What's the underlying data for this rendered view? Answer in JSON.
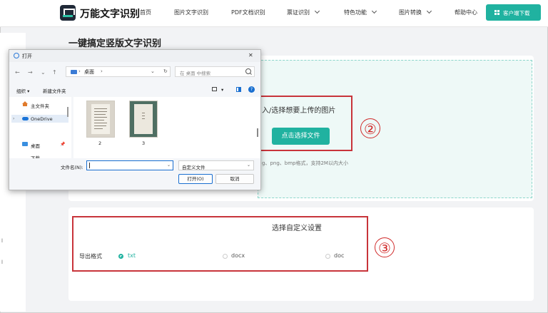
{
  "header": {
    "brand": "万能文字识别",
    "nav": [
      {
        "label": "首页",
        "dropdown": false
      },
      {
        "label": "图片文字识别",
        "dropdown": false
      },
      {
        "label": "PDF文档识别",
        "dropdown": false
      },
      {
        "label": "票证识别",
        "dropdown": true
      },
      {
        "label": "特色功能",
        "dropdown": true
      },
      {
        "label": "图片转换",
        "dropdown": true
      },
      {
        "label": "帮助中心",
        "dropdown": false
      }
    ],
    "download_button": "客户端下载"
  },
  "sidebar": {
    "marks": [
      "l",
      "l"
    ]
  },
  "main": {
    "title": "一键搞定竖版文字识别",
    "upload": {
      "prompt": "入/选择想要上传的图片",
      "choose_button": "点击选择文件",
      "hint": "g、png、bmp格式，支持2M以内大小"
    },
    "settings": {
      "title": "选择自定义设置",
      "export_label": "导出格式",
      "formats": [
        {
          "label": "txt",
          "selected": true
        },
        {
          "label": "docx",
          "selected": false
        },
        {
          "label": "doc",
          "selected": false
        }
      ]
    },
    "annotations": [
      "②",
      "③"
    ]
  },
  "dialog": {
    "title": "打开",
    "close": "✕",
    "nav_buttons": [
      "←",
      "→",
      "⌄",
      "↑"
    ],
    "address": {
      "location": "桌面",
      "sep": "›",
      "chevron": "⌄",
      "refresh": "↻"
    },
    "search_placeholder": "在 桌面 中搜索",
    "toolbar": {
      "organize": "组织 ▾",
      "new_folder": "新建文件夹",
      "view_menu": "▾",
      "help": "?"
    },
    "nav_pane": {
      "items": [
        "主文件夹",
        "OneDrive",
        "桌面",
        "下载"
      ],
      "expand_arrow": "›",
      "pin": "📌"
    },
    "files": [
      {
        "name": "2"
      },
      {
        "name": "3"
      }
    ],
    "filename_label": "文件名(N):",
    "filename_value": "",
    "filename_chevron": "⌄",
    "filter": "自定义文件",
    "filter_chevron": "⌄",
    "open_button": "打开(O)",
    "cancel_button": "取消"
  }
}
